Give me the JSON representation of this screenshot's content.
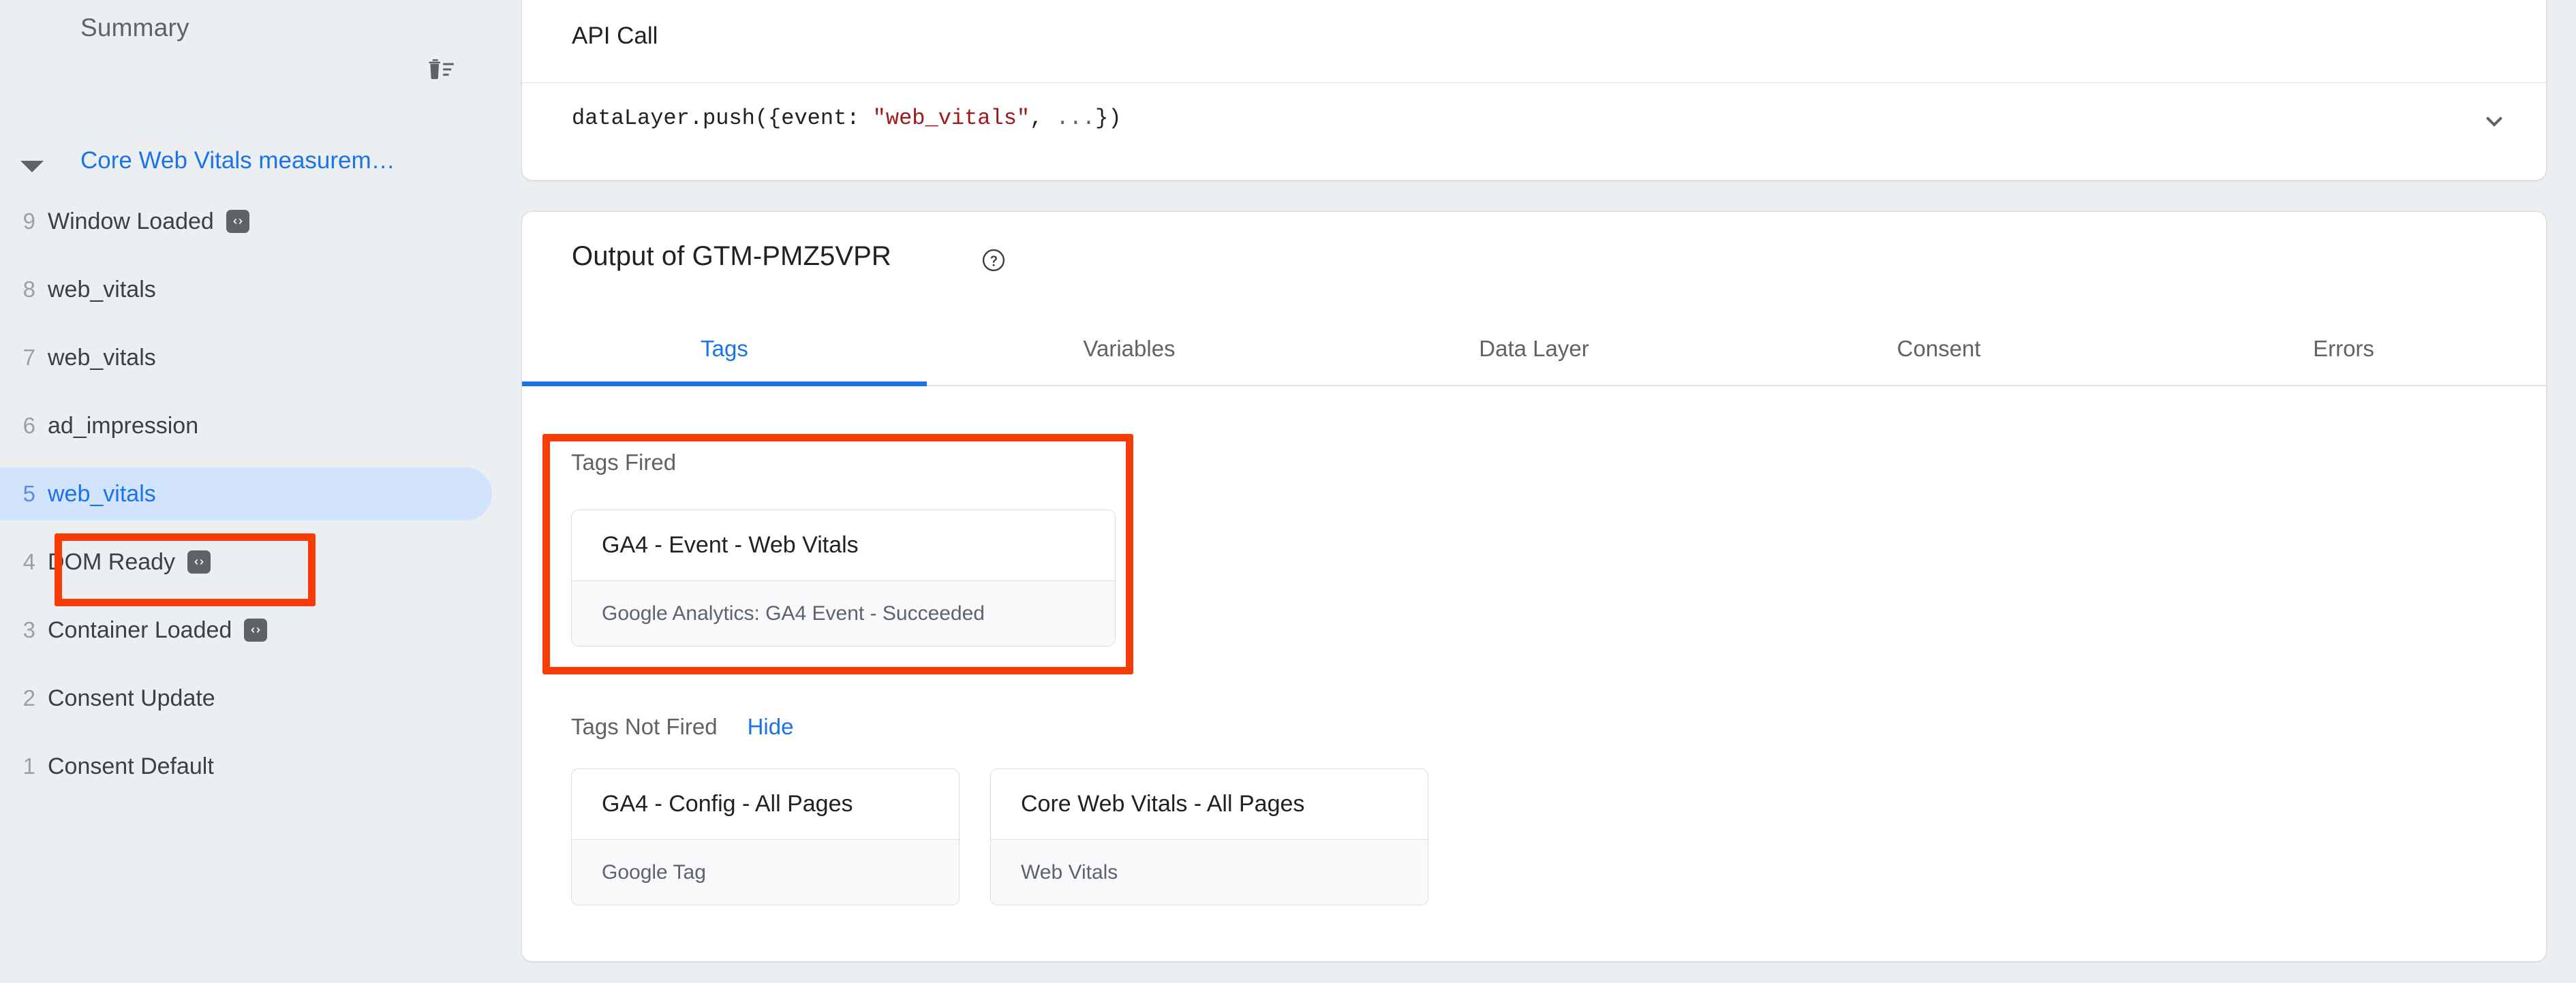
{
  "sidebar": {
    "summary_label": "Summary",
    "delete_icon": "trash-list-icon",
    "group": {
      "caret_icon": "caret-down-icon",
      "title": "Core Web Vitals measurem…"
    },
    "events": [
      {
        "num": "9",
        "label": "Window Loaded",
        "badge": "code-icon",
        "selected": false
      },
      {
        "num": "8",
        "label": "web_vitals",
        "badge": "",
        "selected": false
      },
      {
        "num": "7",
        "label": "web_vitals",
        "badge": "",
        "selected": false
      },
      {
        "num": "6",
        "label": "ad_impression",
        "badge": "",
        "selected": false
      },
      {
        "num": "5",
        "label": "web_vitals",
        "badge": "",
        "selected": true
      },
      {
        "num": "4",
        "label": "DOM Ready",
        "badge": "code-icon",
        "selected": false
      },
      {
        "num": "3",
        "label": "Container Loaded",
        "badge": "code-icon",
        "selected": false
      },
      {
        "num": "2",
        "label": "Consent Update",
        "badge": "",
        "selected": false
      },
      {
        "num": "1",
        "label": "Consent Default",
        "badge": "",
        "selected": false
      }
    ]
  },
  "api_call": {
    "title": "API Call",
    "code_prefix": "dataLayer.push({event: ",
    "code_string": "\"web_vitals\"",
    "code_mid": ", ",
    "code_dots": "...",
    "code_suffix": "})",
    "collapse_icon": "chevron-down-icon"
  },
  "output": {
    "title": "Output of GTM-PMZ5VPR",
    "help_icon": "help-circle-icon",
    "tabs": [
      {
        "label": "Tags",
        "active": true
      },
      {
        "label": "Variables",
        "active": false
      },
      {
        "label": "Data Layer",
        "active": false
      },
      {
        "label": "Consent",
        "active": false
      },
      {
        "label": "Errors",
        "active": false
      }
    ],
    "tags_fired": {
      "title": "Tags Fired",
      "items": [
        {
          "name": "GA4 - Event - Web Vitals",
          "status": "Google Analytics: GA4 Event - Succeeded"
        }
      ]
    },
    "tags_not_fired": {
      "title": "Tags Not Fired",
      "hide_label": "Hide",
      "items": [
        {
          "name": "GA4 - Config - All Pages",
          "status": "Google Tag"
        },
        {
          "name": "Core Web Vitals - All Pages",
          "status": "Web Vitals"
        }
      ]
    }
  },
  "annotations": {
    "color": "#f93b06",
    "boxes": [
      "selected-event-highlight",
      "tags-fired-highlight"
    ]
  },
  "colors": {
    "page_bg": "#eceff1",
    "card_bg": "#ffffff",
    "accent_blue": "#1a73e8",
    "selected_pill": "#d2e3fc",
    "text_primary": "#202124",
    "text_secondary": "#5f6368",
    "code_string": "#a01818"
  }
}
